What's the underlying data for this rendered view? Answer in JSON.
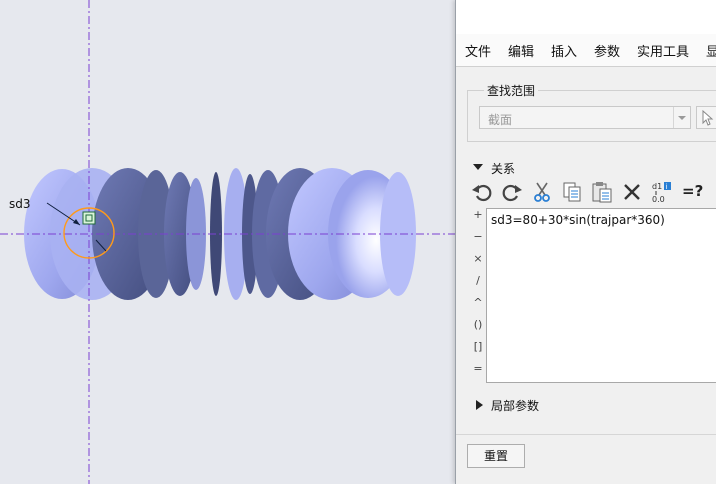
{
  "viewport": {
    "dimension_label": "sd3",
    "colors": {
      "surface": "#a7aff0",
      "surface_dark": "#4f5a8c",
      "axis": "#7b3fd1",
      "highlight": "#ff9a1a"
    }
  },
  "dialog": {
    "menu": [
      "文件",
      "编辑",
      "插入",
      "参数",
      "实用工具",
      "显"
    ],
    "scope": {
      "legend": "查找范围",
      "value": "截面"
    },
    "relations": {
      "title": "关系",
      "toolbar_icons": [
        "undo-icon",
        "redo-icon",
        "cut-icon",
        "copy-icon",
        "paste-icon",
        "delete-icon",
        "evaluate-icon",
        "verify-icon"
      ],
      "verify_label": "=?",
      "operators": [
        "+",
        "−",
        "×",
        "/",
        "^",
        "()",
        "[]",
        "="
      ],
      "text": "sd3=80+30*sin(trajpar*360)"
    },
    "local_params": {
      "title": "局部参数"
    },
    "reset_label": "重置"
  }
}
